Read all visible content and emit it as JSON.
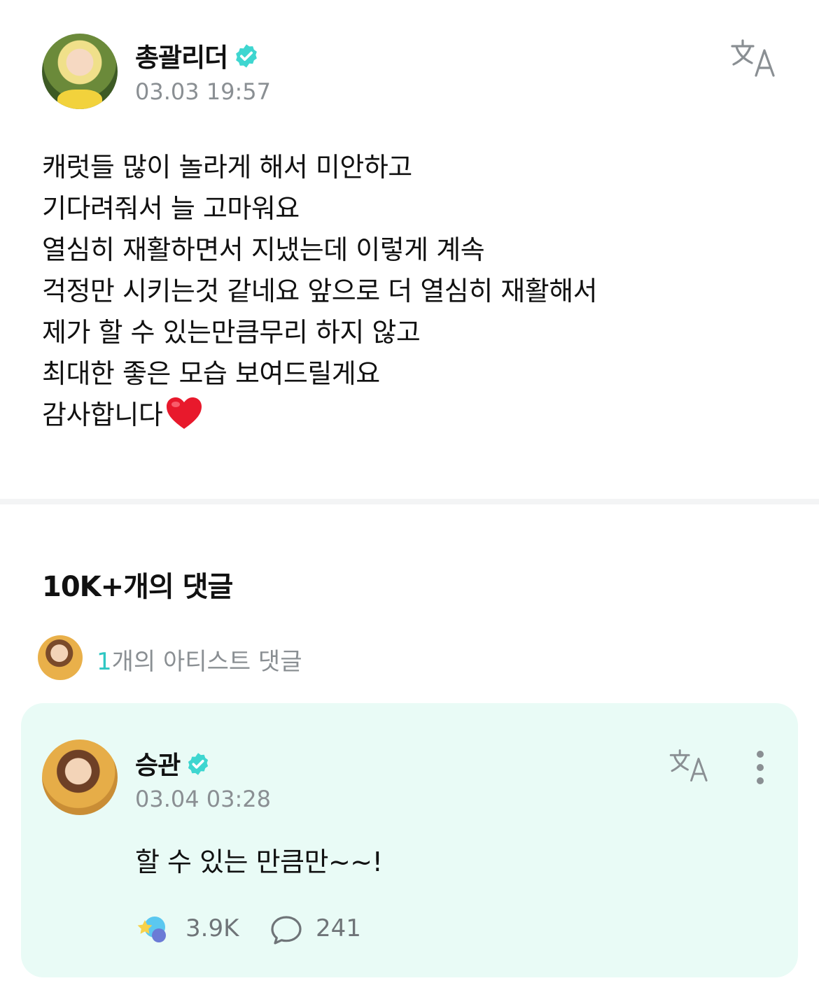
{
  "post": {
    "author": "총괄리더",
    "timestamp": "03.03 19:57",
    "body_lines": [
      "캐럿들 많이 놀라게 해서 미안하고",
      "기다려줘서 늘 고마워요",
      "열심히 재활하면서 지냈는데 이렇게 계속",
      "걱정만 시키는것 같네요 앞으로 더 열심히 재활해서",
      "제가 할 수 있는만큼무리 하지 않고",
      "최대한 좋은 모습 보여드릴게요",
      "감사합니다"
    ],
    "icons": [
      "verified-badge-icon",
      "translate-icon",
      "heart-emoji"
    ]
  },
  "comments": {
    "title": "10K+개의 댓글",
    "artist_count": "1",
    "artist_label": "개의 아티스트 댓글"
  },
  "comment": {
    "author": "승관",
    "timestamp": "03.04 03:28",
    "text": "할 수 있는 만큼만~~!",
    "reaction_count": "3.9K",
    "reply_count": "241",
    "icons": [
      "verified-badge-icon",
      "translate-icon",
      "more-icon",
      "reaction-icon",
      "reply-icon"
    ]
  },
  "colors": {
    "accent": "#2fc7c3",
    "verified": "#3ed6d0",
    "card_bg": "#e9fbf6",
    "muted_text": "#8a8f93"
  }
}
